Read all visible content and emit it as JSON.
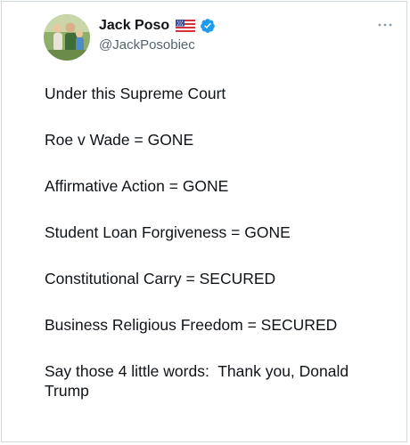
{
  "author": {
    "display_name": "Jack Poso",
    "flag": "us-flag-icon",
    "verified": true,
    "handle": "@JackPosobiec"
  },
  "menu": {
    "icon": "more-options-icon",
    "glyph": "···"
  },
  "tweet": {
    "lines": [
      "Under this Supreme Court",
      "Roe v Wade = GONE",
      "Affirmative Action = GONE",
      "Student Loan Forgiveness = GONE",
      "Constitutional Carry = SECURED",
      "Business Religious Freedom = SECURED",
      "Say those 4 little words:  Thank you, Donald Trump"
    ]
  },
  "colors": {
    "text_primary": "#0f1419",
    "text_secondary": "#536471",
    "verified_blue": "#1d9bf0",
    "border": "#cfd9de"
  }
}
